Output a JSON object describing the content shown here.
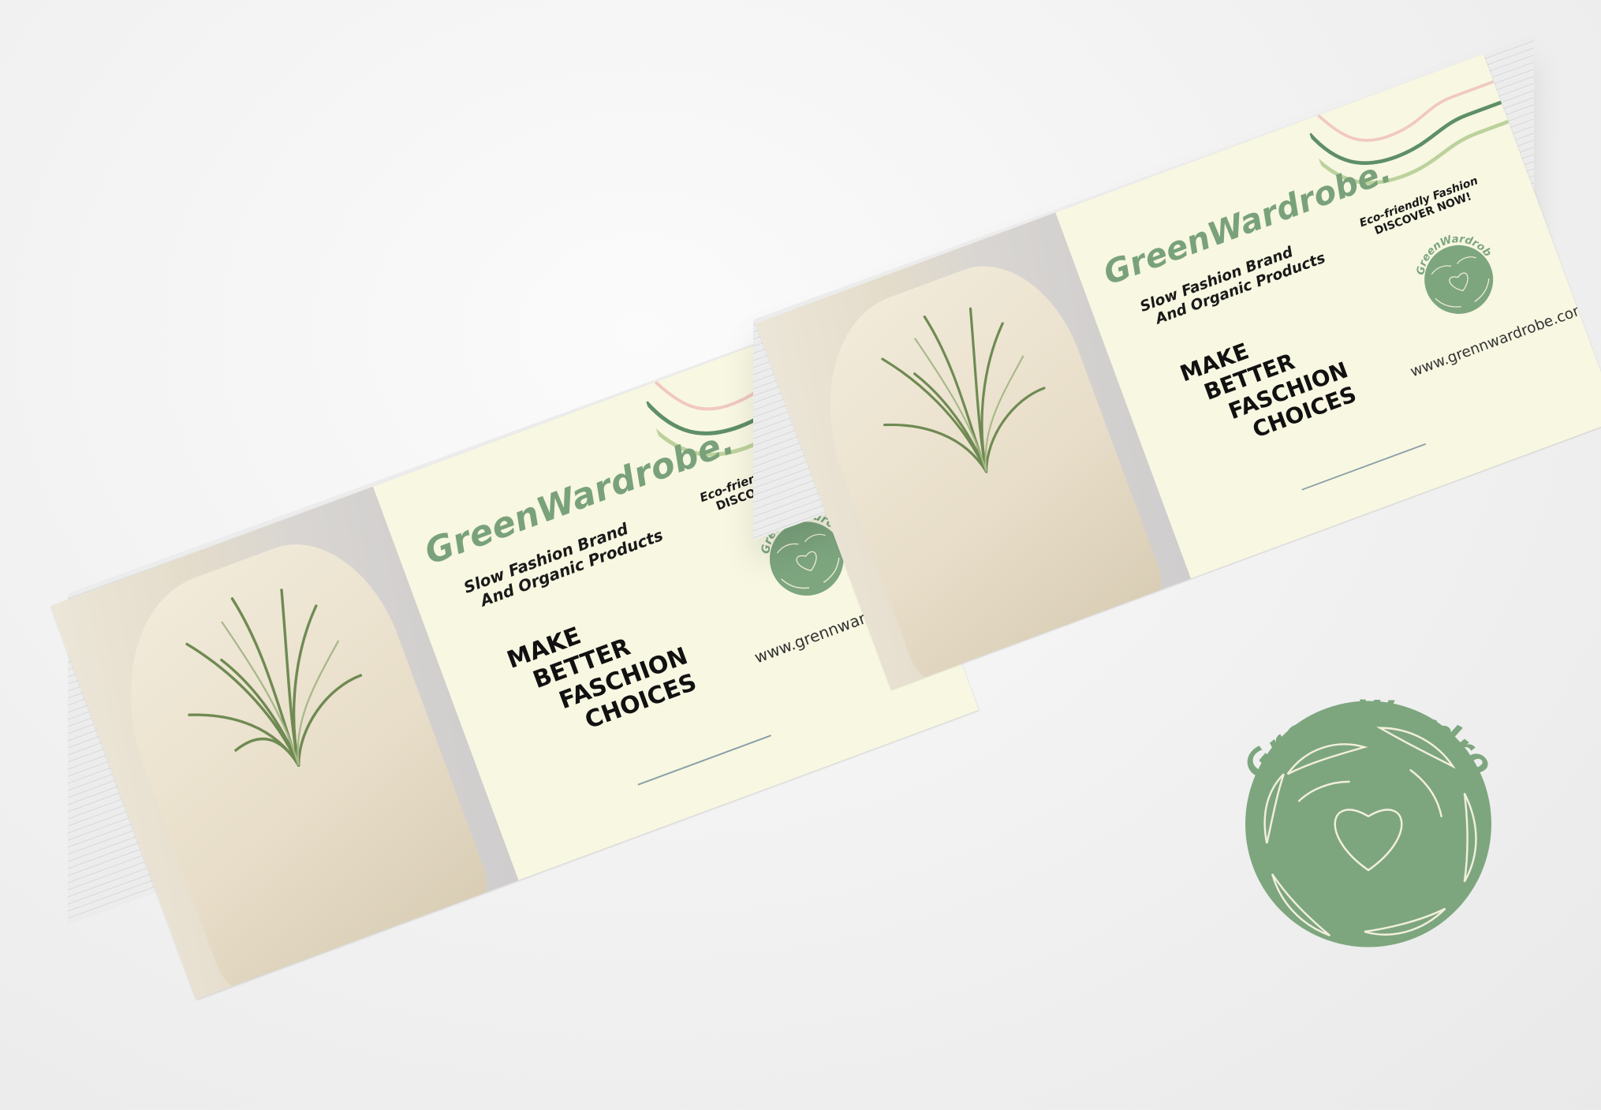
{
  "card": {
    "brand": "GreenWardrobe.",
    "subtitle_line1": "Slow Fashion Brand",
    "subtitle_line2": "And Organic Products",
    "headline": [
      "MAKE",
      "BETTER",
      "FASCHION",
      "CHOICES"
    ],
    "promo_line1": "Eco-friendly Fashion",
    "promo_line2": "DISCOVER NOW!",
    "website": "www.grennwardrobe.com",
    "logo_text": "GreenWardrobe."
  },
  "logo": {
    "text": "GreenWardrobe."
  },
  "colors": {
    "brand_green": "#7da67f",
    "card_cream": "#f8f7e2",
    "accent_pink": "#f0c8c2"
  }
}
